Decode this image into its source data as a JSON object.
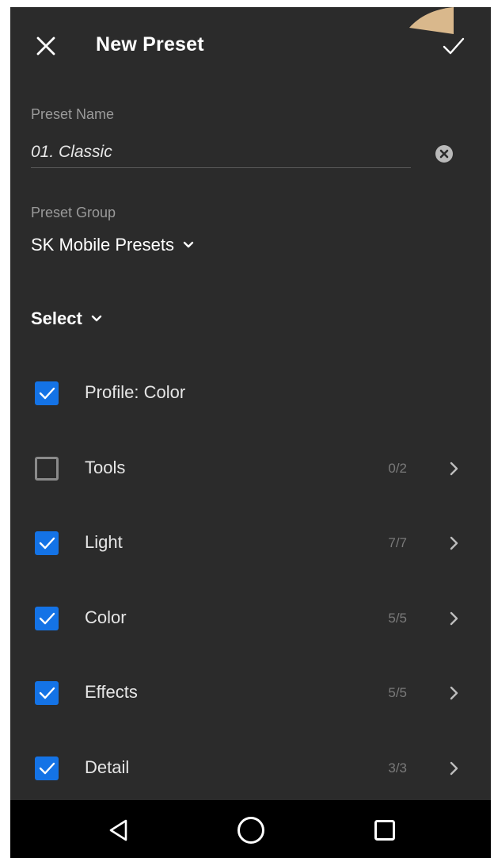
{
  "header": {
    "title": "New Preset",
    "close_icon": "close-icon",
    "confirm_icon": "checkmark-icon"
  },
  "preset_name": {
    "label": "Preset Name",
    "value": "01. Classic",
    "clear_icon": "clear-circle-icon"
  },
  "preset_group": {
    "label": "Preset Group",
    "value": "SK Mobile Presets"
  },
  "select_menu": {
    "label": "Select"
  },
  "settings": [
    {
      "label": "Profile: Color",
      "checked": true,
      "count": "",
      "has_chevron": false
    },
    {
      "label": "Tools",
      "checked": false,
      "count": "0/2",
      "has_chevron": true
    },
    {
      "label": "Light",
      "checked": true,
      "count": "7/7",
      "has_chevron": true
    },
    {
      "label": "Color",
      "checked": true,
      "count": "5/5",
      "has_chevron": true
    },
    {
      "label": "Effects",
      "checked": true,
      "count": "5/5",
      "has_chevron": true
    },
    {
      "label": "Detail",
      "checked": true,
      "count": "3/3",
      "has_chevron": true
    }
  ],
  "nav_bar": {
    "back_icon": "back-triangle-icon",
    "home_icon": "home-circle-icon",
    "recents_icon": "recents-square-icon"
  },
  "colors": {
    "background": "#2b2b2b",
    "accent": "#1473e6",
    "navbar": "#000000",
    "pointer": "#d9b88c"
  }
}
